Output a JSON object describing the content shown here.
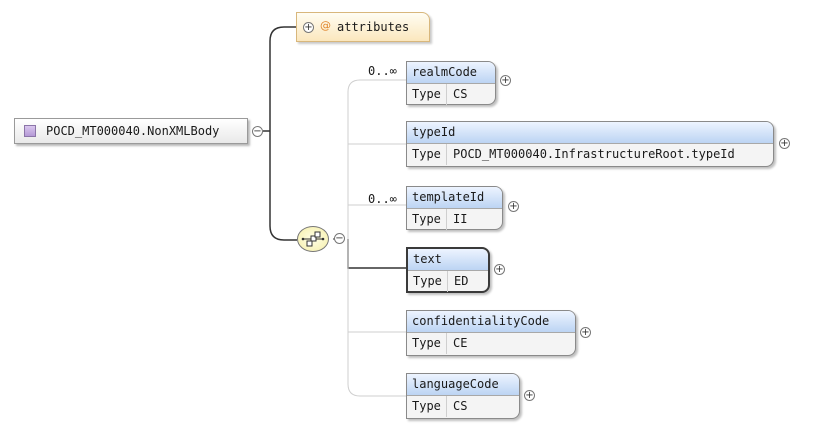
{
  "root": {
    "label": "POCD_MT000040.NonXMLBody"
  },
  "attributes": {
    "at_symbol": "@",
    "label": "attributes"
  },
  "type_label": "Type",
  "sequence_icon": "sequence-compositor-icon",
  "elements": [
    {
      "name": "realmCode",
      "type": "CS",
      "cardinality": "0..∞",
      "bold": false
    },
    {
      "name": "typeId",
      "type": "POCD_MT000040.InfrastructureRoot.typeId",
      "cardinality": "",
      "bold": false
    },
    {
      "name": "templateId",
      "type": "II",
      "cardinality": "0..∞",
      "bold": false
    },
    {
      "name": "text",
      "type": "ED",
      "cardinality": "",
      "bold": true
    },
    {
      "name": "confidentialityCode",
      "type": "CE",
      "cardinality": "",
      "bold": false
    },
    {
      "name": "languageCode",
      "type": "CS",
      "cardinality": "",
      "bold": false
    }
  ],
  "colors": {
    "header": "#bcd4f3",
    "attributes_bg": "#fbe7bd",
    "sequence_bg": "#f5eea8",
    "root_icon": "#b59ad6"
  }
}
